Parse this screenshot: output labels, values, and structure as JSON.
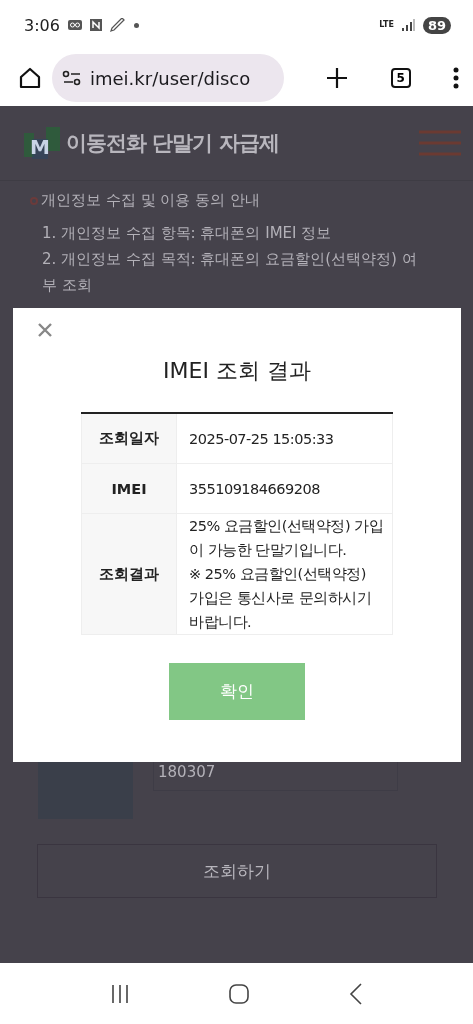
{
  "status_bar": {
    "time": "3:06",
    "network": "LTE",
    "battery": "89"
  },
  "browser": {
    "url": "imei.kr/user/disco",
    "tab_count": "5"
  },
  "page": {
    "logo_mark": "M",
    "site_title": "이동전화 단말기 자급제",
    "notice_heading": "개인정보 수집 및 이용 동의 안내",
    "notice_lines": [
      "1. 개인정보 수집 항목: 휴대폰의 IMEI 정보",
      "2. 개인정보 수집 목적: 휴대폰의 요금할인(선택약정) 여부 조회"
    ],
    "field_value": "180307",
    "submit_button": "조회하기"
  },
  "dialog": {
    "title": "IMEI 조회 결과",
    "rows": [
      {
        "label": "조회일자",
        "value": "2025-07-25 15:05:33"
      },
      {
        "label": "IMEI",
        "value": "355109184669208"
      },
      {
        "label": "조회결과",
        "value": "25% 요금할인(선택약정) 가입이 가능한 단말기입니다.\n※ 25% 요금할인(선택약정) 가입은 통신사로 문의하시기 바랍니다."
      }
    ],
    "confirm_button": "확인"
  }
}
